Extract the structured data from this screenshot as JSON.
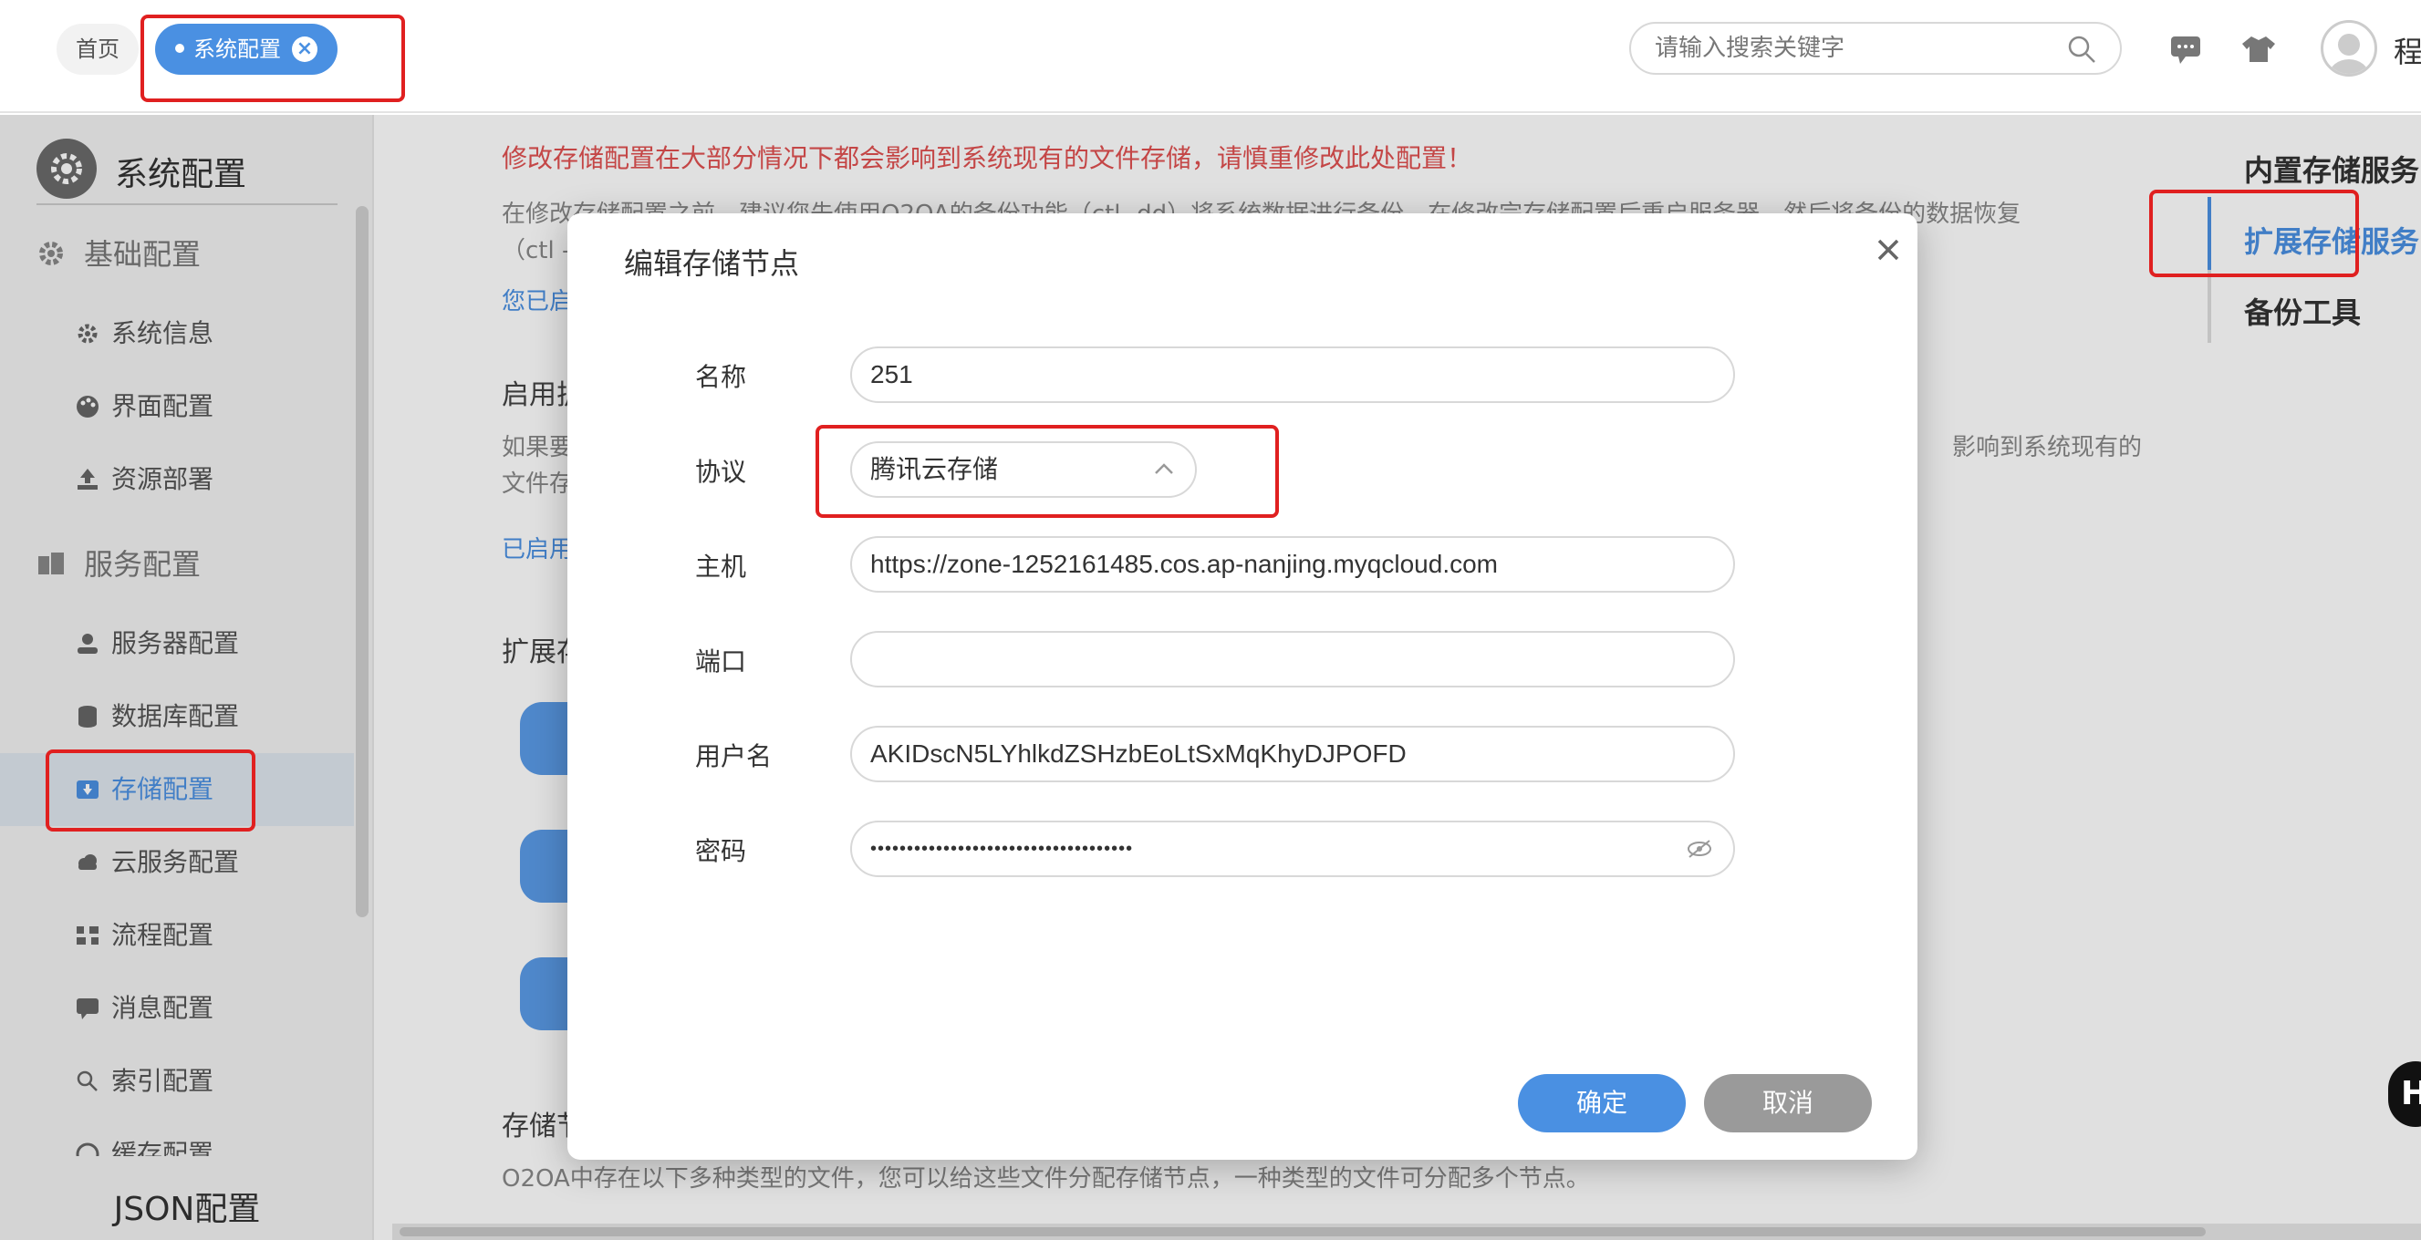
{
  "topbar": {
    "home_tab": "首页",
    "active_tab": "系统配置",
    "search_placeholder": "请输入搜索关键字",
    "user_name": "程"
  },
  "sidebar": {
    "title": "系统配置",
    "groups": [
      {
        "label": "基础配置"
      },
      {
        "label": "服务配置"
      }
    ],
    "items": [
      {
        "label": "系统信息"
      },
      {
        "label": "界面配置"
      },
      {
        "label": "资源部署"
      },
      {
        "label": "服务器配置"
      },
      {
        "label": "数据库配置"
      },
      {
        "label": "存储配置"
      },
      {
        "label": "云服务配置"
      },
      {
        "label": "流程配置"
      },
      {
        "label": "消息配置"
      },
      {
        "label": "索引配置"
      },
      {
        "label": "缓存配置"
      }
    ],
    "json_config": "JSON配置"
  },
  "content": {
    "warning": "修改存储配置在大部分情况下都会影响到系统现有的文件存储，请慎重修改此处配置！",
    "para1": "在修改存储配置之前，建议您先使用O2OA的备份功能（ctl -dd）将系统数据进行备份，在修改完存储配置后重启服务器，然后将备份的数据恢复",
    "para1b": "（ctl -",
    "link1": "您已启",
    "heading1": "启用扩",
    "para2": "如果要",
    "para2_right": "影响到系统现有的",
    "para2b": "文件存",
    "link2": "已启用",
    "heading2": "扩展存",
    "heading3": "存储节",
    "footer_text": "O2OA中存在以下多种类型的文件，您可以给这些文件分配存储节点，一种类型的文件可分配多个节点。"
  },
  "rightnav": {
    "items": [
      {
        "label": "内置存储服务"
      },
      {
        "label": "扩展存储服务"
      },
      {
        "label": "备份工具"
      }
    ]
  },
  "modal": {
    "title": "编辑存储节点",
    "fields": {
      "name_label": "名称",
      "name_value": "251",
      "protocol_label": "协议",
      "protocol_value": "腾讯云存储",
      "host_label": "主机",
      "host_value": "https://zone-1252161485.cos.ap-nanjing.myqcloud.com",
      "port_label": "端口",
      "port_value": "",
      "username_label": "用户名",
      "username_value": "AKIDscN5LYhlkdZSHzbEoLtSxMqKhyDJPOFD",
      "password_label": "密码",
      "password_value": "••••••••••••••••••••••••••••••••••••"
    },
    "ok_label": "确定",
    "cancel_label": "取消"
  },
  "floating_badge": "H"
}
